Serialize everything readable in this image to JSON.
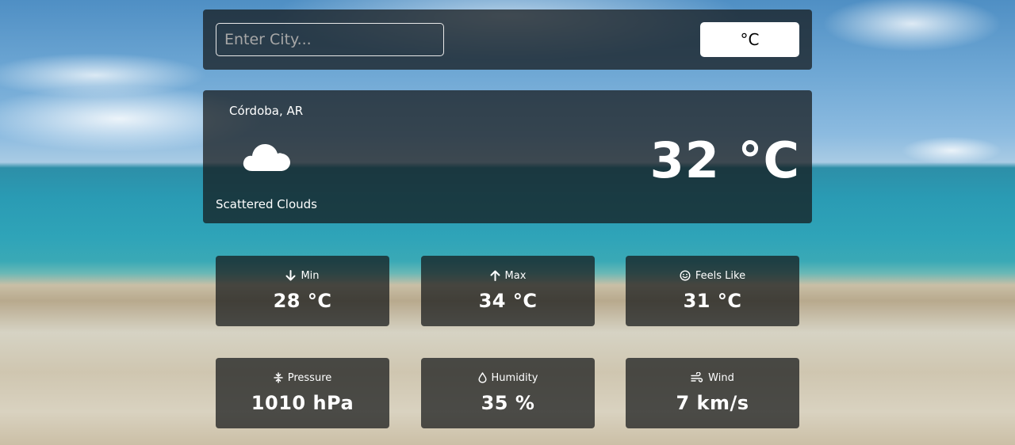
{
  "search": {
    "placeholder": "Enter City...",
    "value": ""
  },
  "unit_toggle": {
    "label": "°C"
  },
  "current": {
    "location": "Córdoba, AR",
    "icon": "cloud-icon",
    "description": "Scattered Clouds",
    "temperature": "32 °C"
  },
  "details": {
    "min": {
      "icon": "arrow-down-icon",
      "label": "Min",
      "value": "28 °C"
    },
    "max": {
      "icon": "arrow-up-icon",
      "label": "Max",
      "value": "34 °C"
    },
    "feels_like": {
      "icon": "smile-icon",
      "label": "Feels Like",
      "value": "31 °C"
    },
    "pressure": {
      "icon": "compress-icon",
      "label": "Pressure",
      "value": "1010 hPa"
    },
    "humidity": {
      "icon": "droplet-icon",
      "label": "Humidity",
      "value": "35 %"
    },
    "wind": {
      "icon": "wind-icon",
      "label": "Wind",
      "value": "7 km/s"
    }
  }
}
